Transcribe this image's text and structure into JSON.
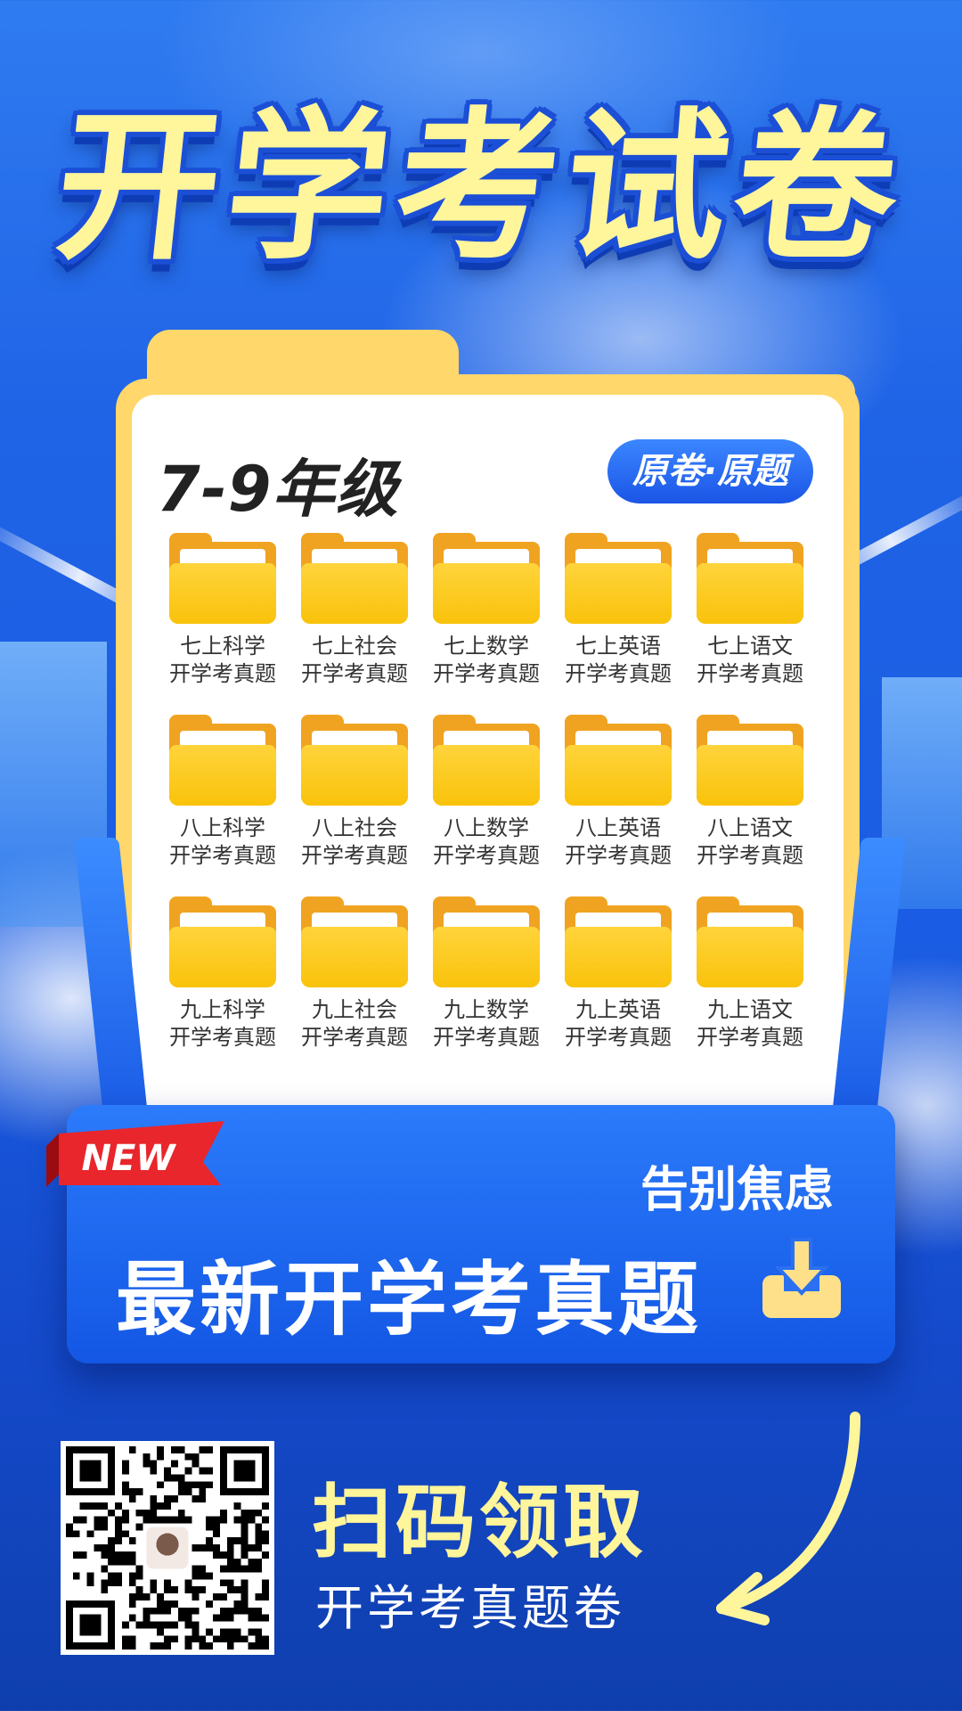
{
  "title": "开学考试卷",
  "card": {
    "grade": "7-9年级",
    "badge": "原卷·原题",
    "folders": [
      {
        "line1": "七上科学",
        "line2": "开学考真题"
      },
      {
        "line1": "七上社会",
        "line2": "开学考真题"
      },
      {
        "line1": "七上数学",
        "line2": "开学考真题"
      },
      {
        "line1": "七上英语",
        "line2": "开学考真题"
      },
      {
        "line1": "七上语文",
        "line2": "开学考真题"
      },
      {
        "line1": "八上科学",
        "line2": "开学考真题"
      },
      {
        "line1": "八上社会",
        "line2": "开学考真题"
      },
      {
        "line1": "八上数学",
        "line2": "开学考真题"
      },
      {
        "line1": "八上英语",
        "line2": "开学考真题"
      },
      {
        "line1": "八上语文",
        "line2": "开学考真题"
      },
      {
        "line1": "九上科学",
        "line2": "开学考真题"
      },
      {
        "line1": "九上社会",
        "line2": "开学考真题"
      },
      {
        "line1": "九上数学",
        "line2": "开学考真题"
      },
      {
        "line1": "九上英语",
        "line2": "开学考真题"
      },
      {
        "line1": "九上语文",
        "line2": "开学考真题"
      }
    ]
  },
  "promo": {
    "new_tag": "NEW",
    "slogan_small": "告别焦虑",
    "slogan_big": "最新开学考真题",
    "download_icon": "download-icon"
  },
  "bottom": {
    "qr_icon": "qr-code-icon",
    "cta_big": "扫码领取",
    "cta_small": "开学考真题卷",
    "arrow_icon": "curved-arrow-icon"
  },
  "colors": {
    "background": "#1f63e6",
    "title": "#fff59a",
    "folder_card": "#ffd76a",
    "badge": "#1b55e6",
    "new_tag": "#e8262b"
  }
}
